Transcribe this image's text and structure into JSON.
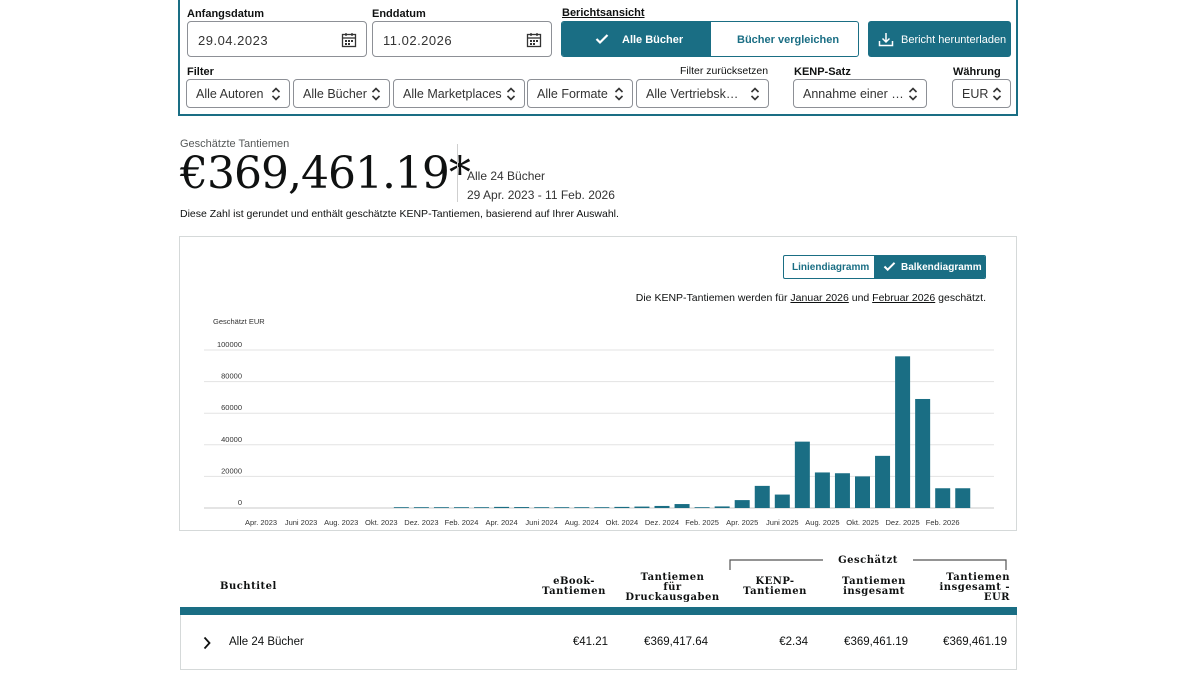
{
  "filters": {
    "start_label": "Anfangsdatum",
    "start_value": "29.04.2023",
    "end_label": "Enddatum",
    "end_value": "11.02.2026",
    "view_label": "Berichtsansicht",
    "view_all": "Alle Bücher",
    "view_compare": "Bücher vergleichen",
    "download": "Bericht herunterladen",
    "filter_label": "Filter",
    "reset": "Filter zurücksetzen",
    "kenp_label": "KENP-Satz",
    "currency_label": "Währung",
    "authors": "Alle Autoren",
    "books": "Alle Bücher",
    "marketplaces": "Alle Marketplaces",
    "formats": "Alle Formate",
    "channels": "Alle Vertriebsk…",
    "kenp_value": "Annahme einer …",
    "currency_value": "EUR"
  },
  "summary": {
    "label": "Geschätzte Tantiemen",
    "amount": "€369,461.19*",
    "books": "Alle 24 Bücher",
    "range": "29 Apr. 2023 - 11 Feb. 2026",
    "note": "Diese Zahl ist gerundet und enthält geschätzte KENP-Tantiemen, basierend auf Ihrer Auswahl."
  },
  "chart_controls": {
    "line": "Liniendiagramm",
    "bar": "Balkendiagramm",
    "kenp_note_pre": "Die KENP-Tantiemen werden für ",
    "kenp_month1": "Januar 2026",
    "kenp_note_mid": " und ",
    "kenp_month2": "Februar 2026",
    "kenp_note_post": " geschätzt."
  },
  "chart_data": {
    "type": "bar",
    "ylabel": "Geschätzt EUR",
    "ylim": [
      0,
      100000
    ],
    "yticks": [
      0,
      20000,
      40000,
      60000,
      80000,
      100000
    ],
    "x_tick_labels": [
      "Apr. 2023",
      "Juni 2023",
      "Aug. 2023",
      "Okt. 2023",
      "Dez. 2023",
      "Feb. 2024",
      "Apr. 2024",
      "Juni 2024",
      "Aug. 2024",
      "Okt. 2024",
      "Dez. 2024",
      "Feb. 2025",
      "Apr. 2025",
      "Juni 2025",
      "Aug. 2025",
      "Okt. 2025",
      "Dez. 2025",
      "Feb. 2026"
    ],
    "categories": [
      "Apr. 2023",
      "Mai 2023",
      "Juni 2023",
      "Juli 2023",
      "Aug. 2023",
      "Sep. 2023",
      "Okt. 2023",
      "Nov. 2023",
      "Dez. 2023",
      "Jan. 2024",
      "Feb. 2024",
      "März 2024",
      "Apr. 2024",
      "Mai 2024",
      "Juni 2024",
      "Juli 2024",
      "Aug. 2024",
      "Sep. 2024",
      "Okt. 2024",
      "Nov. 2024",
      "Dez. 2024",
      "Jan. 2025",
      "Feb. 2025",
      "März 2025",
      "Apr. 2025",
      "Mai 2025",
      "Juni 2025",
      "Juli 2025",
      "Aug. 2025",
      "Sep. 2025",
      "Okt. 2025",
      "Nov. 2025",
      "Dez. 2025",
      "Jan. 2026",
      "Feb. 2026"
    ],
    "values": [
      0,
      0,
      0,
      0,
      0,
      0,
      0,
      200,
      300,
      400,
      500,
      400,
      700,
      600,
      500,
      300,
      400,
      300,
      700,
      900,
      1300,
      2500,
      300,
      1000,
      5000,
      14000,
      8500,
      42000,
      22500,
      22000,
      20000,
      33000,
      96000,
      69000,
      12500,
      12500
    ]
  },
  "table": {
    "headers": {
      "title": "Buchtitel",
      "ebook": [
        "eBook-",
        "Tantiemen"
      ],
      "print": [
        "Tantiemen",
        "für",
        "Druckausgaben"
      ],
      "estimated": "Geschätzt",
      "kenp": [
        "KENP-",
        "Tantiemen"
      ],
      "total": [
        "Tantiemen",
        "insgesamt"
      ],
      "total_eur": [
        "Tantiemen",
        "insgesamt -",
        "EUR"
      ]
    },
    "row": {
      "title": "Alle 24 Bücher",
      "ebook": "€41.21",
      "print": "€369,417.64",
      "kenp": "€2.34",
      "total": "€369,461.19",
      "total_eur": "€369,461.19"
    }
  },
  "colors": {
    "accent": "#1a6e84",
    "bar": "#1a6e84"
  }
}
